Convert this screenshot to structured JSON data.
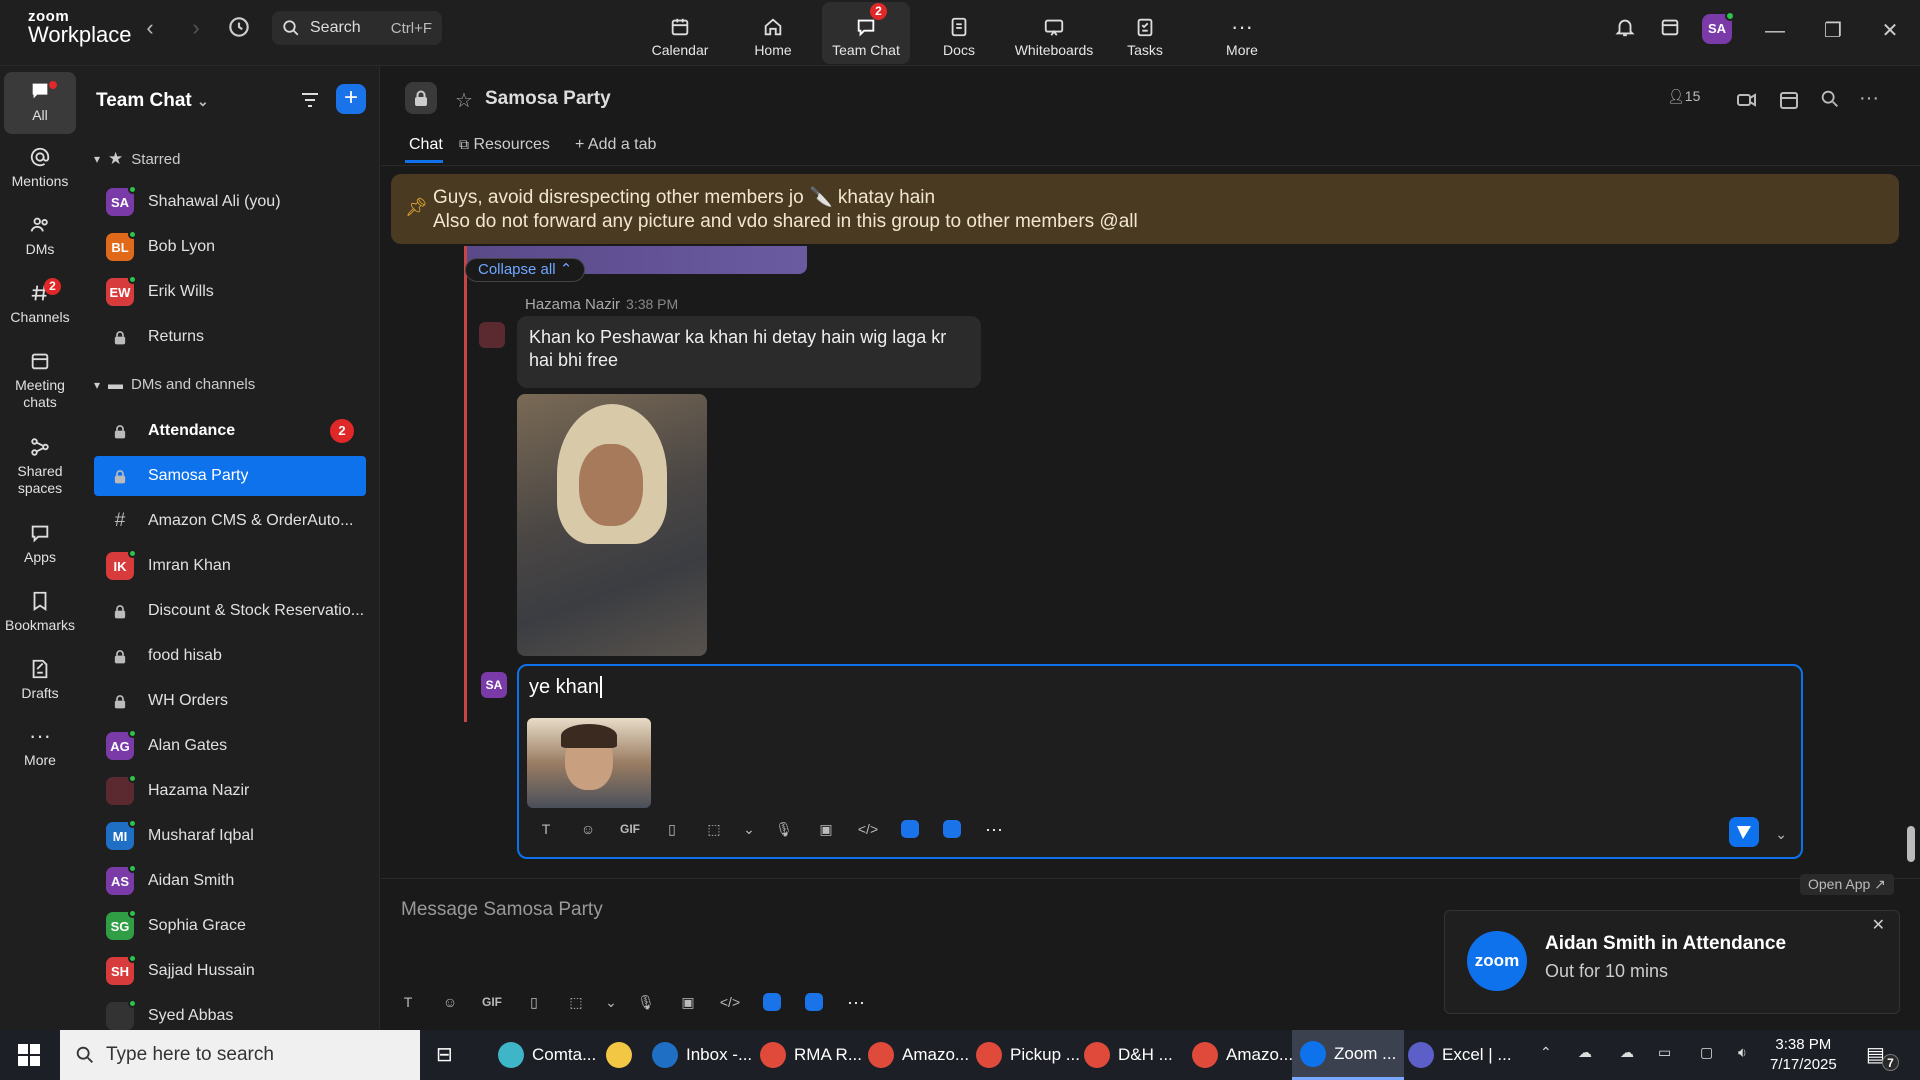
{
  "topbar": {
    "logo_line1": "zoom",
    "logo_line2": "Workplace",
    "search_label": "Search",
    "search_shortcut": "Ctrl+F",
    "nav": [
      {
        "label": "Calendar",
        "icon": "calendar-icon"
      },
      {
        "label": "Home",
        "icon": "home-icon"
      },
      {
        "label": "Team Chat",
        "icon": "chat-icon",
        "badge": "2",
        "active": true
      },
      {
        "label": "Docs",
        "icon": "docs-icon"
      },
      {
        "label": "Whiteboards",
        "icon": "whiteboard-icon"
      },
      {
        "label": "Tasks",
        "icon": "tasks-icon"
      },
      {
        "label": "More",
        "icon": "more-icon"
      }
    ],
    "avatar_initials": "SA"
  },
  "rail": [
    {
      "label": "All",
      "icon": "chat-bubble-icon",
      "active": true
    },
    {
      "label": "Mentions",
      "icon": "at-icon"
    },
    {
      "label": "DMs",
      "icon": "people-icon"
    },
    {
      "label": "Channels",
      "icon": "hash-icon",
      "badge": "2"
    },
    {
      "label": "Meeting chats",
      "icon": "calendar-icon"
    },
    {
      "label": "Shared spaces",
      "icon": "share-icon"
    },
    {
      "label": "Apps",
      "icon": "apps-icon"
    },
    {
      "label": "Bookmarks",
      "icon": "bookmark-icon"
    },
    {
      "label": "Drafts",
      "icon": "drafts-icon"
    },
    {
      "label": "More",
      "icon": "more-icon"
    }
  ],
  "sidebar": {
    "title": "Team Chat",
    "starred_label": "Starred",
    "starred": [
      {
        "name": "Shahawal Ali (you)",
        "initials": "SA",
        "color": "#7a3aa8",
        "online": true
      },
      {
        "name": "Bob Lyon",
        "initials": "BL",
        "color": "#e06a1a",
        "online": true
      },
      {
        "name": "Erik Wills",
        "initials": "EW",
        "color": "#d83b3b",
        "online": true
      },
      {
        "name": "Returns",
        "type": "lock"
      }
    ],
    "dms_label": "DMs and channels",
    "dms": [
      {
        "name": "Attendance",
        "type": "lock",
        "bold": true,
        "count": "2"
      },
      {
        "name": "Samosa Party",
        "type": "lock",
        "selected": true
      },
      {
        "name": "Amazon CMS & OrderAuto...",
        "type": "hash"
      },
      {
        "name": "Imran Khan",
        "initials": "IK",
        "color": "#d83b3b",
        "online": true
      },
      {
        "name": "Discount & Stock Reservatio...",
        "type": "lock"
      },
      {
        "name": "food hisab",
        "type": "lock"
      },
      {
        "name": "WH Orders",
        "type": "lock"
      },
      {
        "name": "Alan Gates",
        "initials": "AG",
        "color": "#7a3aa8",
        "online": true
      },
      {
        "name": "Hazama Nazir",
        "initials": "",
        "color": "#5a2a30",
        "online": true
      },
      {
        "name": "Musharaf Iqbal",
        "initials": "MI",
        "color": "#1f6fc4",
        "online": true
      },
      {
        "name": "Aidan Smith",
        "initials": "AS",
        "color": "#7a3aa8",
        "online": true
      },
      {
        "name": "Sophia Grace",
        "initials": "SG",
        "color": "#2f9e44",
        "online": true
      },
      {
        "name": "Sajjad Hussain",
        "initials": "SH",
        "color": "#d83b3b",
        "online": true
      },
      {
        "name": "Syed Abbas",
        "initials": "",
        "color": "#333333",
        "online": true
      }
    ]
  },
  "channel": {
    "name": "Samosa Party",
    "member_count": "15",
    "tabs": [
      "Chat",
      "Resources",
      "Add a tab"
    ]
  },
  "pinned": {
    "line1": "Guys, avoid disrespecting other members jo 🔪 khatay hain",
    "line2": "Also do not forward any picture and vdo shared in this group to other members @all"
  },
  "thread": {
    "collapse_label": "Collapse all",
    "sender": "Hazama Nazir",
    "time": "3:38 PM",
    "message": "Khan ko Peshawar ka khan hi detay hain wig laga kr hai bhi free"
  },
  "composer": {
    "avatar_initials": "SA",
    "text": "ye khan"
  },
  "bottom_composer": {
    "placeholder": "Message Samosa Party"
  },
  "notification": {
    "logo_text": "zoom",
    "title": "Aidan Smith in Attendance",
    "body": "Out for 10 mins",
    "open_app": "Open App ↗"
  },
  "taskbar": {
    "search_placeholder": "Type here to search",
    "apps": [
      {
        "label": "Comta...",
        "color": "#3fb5c8"
      },
      {
        "label": "",
        "color": "#f2c744"
      },
      {
        "label": "Inbox -...",
        "color": "#1f6fc4"
      },
      {
        "label": "RMA R...",
        "color": "#e04a3a"
      },
      {
        "label": "Amazo...",
        "color": "#e04a3a"
      },
      {
        "label": "Pickup ...",
        "color": "#e04a3a"
      },
      {
        "label": "D&H ...",
        "color": "#e04a3a"
      },
      {
        "label": "Amazo...",
        "color": "#e04a3a"
      },
      {
        "label": "Zoom ...",
        "color": "#0e72ed",
        "active": true
      },
      {
        "label": "Excel | ...",
        "color": "#5b5fc7"
      }
    ],
    "time": "3:38 PM",
    "date": "7/17/2025",
    "notif_count": "7"
  }
}
